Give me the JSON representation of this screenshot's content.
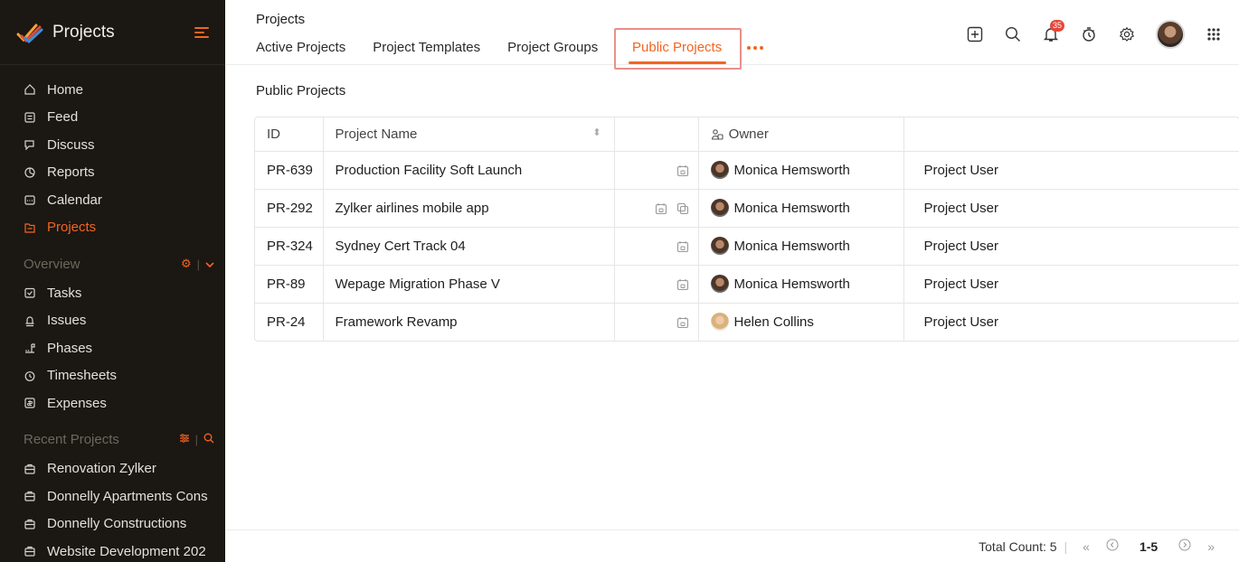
{
  "app": {
    "title": "Projects",
    "accent_color": "#f26522",
    "sidebar_bg": "#1b1712"
  },
  "sidebar": {
    "nav": [
      {
        "label": "Home",
        "icon": "home-icon"
      },
      {
        "label": "Feed",
        "icon": "feed-icon"
      },
      {
        "label": "Discuss",
        "icon": "discuss-icon"
      },
      {
        "label": "Reports",
        "icon": "reports-icon"
      },
      {
        "label": "Calendar",
        "icon": "calendar-icon"
      },
      {
        "label": "Projects",
        "icon": "projects-icon",
        "active": true
      }
    ],
    "overview": {
      "label": "Overview",
      "items": [
        {
          "label": "Tasks",
          "icon": "tasks-icon"
        },
        {
          "label": "Issues",
          "icon": "issues-icon"
        },
        {
          "label": "Phases",
          "icon": "phases-icon"
        },
        {
          "label": "Timesheets",
          "icon": "timesheets-icon"
        },
        {
          "label": "Expenses",
          "icon": "expenses-icon"
        }
      ]
    },
    "recent": {
      "label": "Recent Projects",
      "items": [
        {
          "label": "Renovation Zylker"
        },
        {
          "label": "Donnelly Apartments Cons"
        },
        {
          "label": "Donnelly Constructions"
        },
        {
          "label": "Website Development 202"
        }
      ]
    }
  },
  "header": {
    "title": "Projects",
    "tabs": [
      {
        "label": "Active Projects"
      },
      {
        "label": "Project Templates"
      },
      {
        "label": "Project Groups"
      }
    ],
    "active_tab": "Public Projects",
    "notification_count": "35"
  },
  "main": {
    "heading": "Public Projects",
    "columns": {
      "id": "ID",
      "name": "Project Name",
      "owner": "Owner"
    },
    "rows": [
      {
        "id": "PR-639",
        "name": "Production Facility Soft Launch",
        "owner": "Monica Hemsworth",
        "role": "Project User",
        "icons": [
          "calendar-lock-icon"
        ],
        "avatar": "monica"
      },
      {
        "id": "PR-292",
        "name": "Zylker airlines mobile app",
        "owner": "Monica Hemsworth",
        "role": "Project User",
        "icons": [
          "calendar-lock-icon",
          "copy-icon"
        ],
        "avatar": "monica"
      },
      {
        "id": "PR-324",
        "name": "Sydney Cert Track 04",
        "owner": "Monica Hemsworth",
        "role": "Project User",
        "icons": [
          "calendar-lock-icon"
        ],
        "avatar": "monica"
      },
      {
        "id": "PR-89",
        "name": "Wepage Migration Phase V",
        "owner": "Monica Hemsworth",
        "role": "Project User",
        "icons": [
          "calendar-lock-icon"
        ],
        "avatar": "monica"
      },
      {
        "id": "PR-24",
        "name": "Framework Revamp",
        "owner": "Helen Collins",
        "role": "Project User",
        "icons": [
          "calendar-lock-icon"
        ],
        "avatar": "helen"
      }
    ]
  },
  "footer": {
    "total_label": "Total Count: 5",
    "range": "1-5"
  }
}
